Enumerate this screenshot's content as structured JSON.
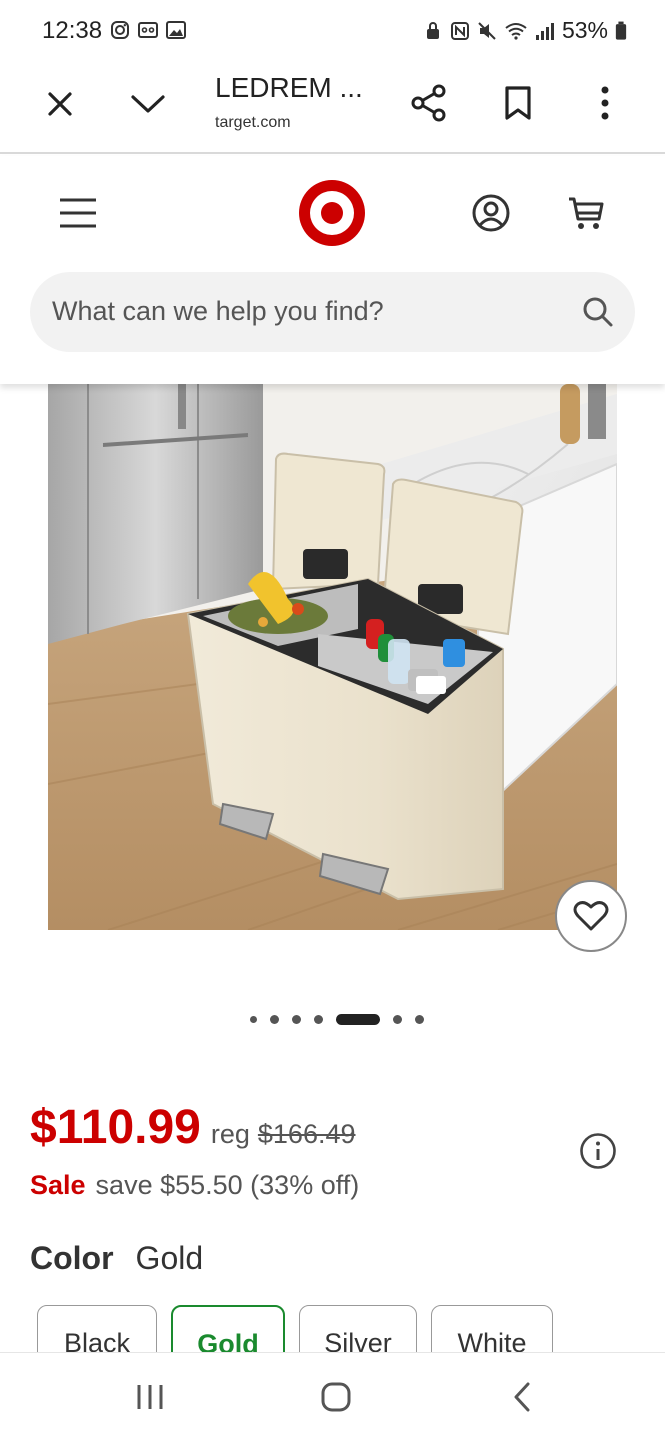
{
  "status_bar": {
    "time": "12:38",
    "battery": "53%",
    "left_icons": [
      "instagram-icon",
      "voicemail-icon",
      "gallery-icon"
    ],
    "right_icons": [
      "lock-icon",
      "nfc-icon",
      "mute-icon",
      "wifi-icon",
      "signal-icon",
      "battery-icon"
    ]
  },
  "tab_bar": {
    "title": "LEDREM ...",
    "url": "target.com",
    "icons": [
      "close-icon",
      "chevron-down-icon",
      "share-icon",
      "bookmark-icon",
      "more-vert-icon"
    ]
  },
  "header": {
    "logo": "target-logo",
    "search_placeholder": "What can we help you find?",
    "icons": [
      "menu-icon",
      "account-icon",
      "cart-icon",
      "search-icon"
    ]
  },
  "carousel": {
    "dot_count": 7,
    "active_index": 4
  },
  "product": {
    "price": "$110.99",
    "reg_label": "reg",
    "reg_price": "$166.49",
    "sale_label": "Sale",
    "sale_text": "save $55.50 (33% off)",
    "color_label": "Color",
    "color_value": "Gold",
    "swatches": [
      "Black",
      "Gold",
      "Silver",
      "White"
    ],
    "selected_swatch": "Gold"
  },
  "colors": {
    "brand_red": "#cc0000",
    "selected_green": "#1a8a2e"
  },
  "nav_bar": {
    "icons": [
      "recent-apps-icon",
      "home-icon",
      "back-icon"
    ]
  }
}
